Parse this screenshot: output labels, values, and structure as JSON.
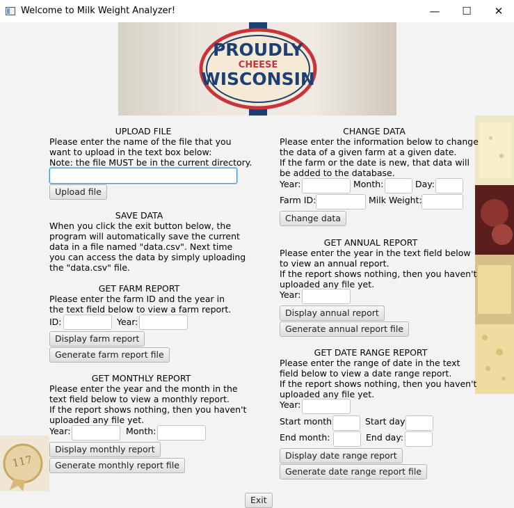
{
  "window": {
    "title": "Welcome to Milk Weight Analyzer!",
    "minimize": "—",
    "maximize": "☐",
    "close": "✕"
  },
  "banner": {
    "line1": "PROUDLY",
    "line2": "CHEESE",
    "line3": "WISCONSIN"
  },
  "badge": {
    "text": "117"
  },
  "upload": {
    "heading": "UPLOAD FILE",
    "line1": "Please enter the name of the file that you",
    "line2": "want to upload in the text box below:",
    "line3": "Note: the file MUST be in the current directory.",
    "value": "",
    "button": "Upload file"
  },
  "save": {
    "heading": "SAVE DATA",
    "lines": [
      "When you click the exit button below, the",
      "program will automatically save the current",
      "data in a file named \"data.csv\". Next time",
      "you can access the data by simply uploading",
      "the \"data.csv\" file."
    ]
  },
  "farm": {
    "heading": "GET FARM REPORT",
    "line1": "Please enter the farm ID and the year in",
    "line2": "the text field below to view a farm report.",
    "id_label": "ID:",
    "year_label": "Year:",
    "display_button": "Display farm report",
    "generate_button": "Generate farm report file"
  },
  "monthly": {
    "heading": "GET MONTHLY REPORT",
    "lines": [
      "Please enter the year and the month in the",
      "text field below to view a monthly report.",
      "If the report shows nothing, then you haven't",
      "uploaded any file yet."
    ],
    "year_label": "Year:",
    "month_label": "Month:",
    "display_button": "Display monthly report",
    "generate_button": "Generate monthly report file"
  },
  "change": {
    "heading": "CHANGE DATA",
    "lines": [
      "Please enter the information below to change",
      "the data of a given farm at a given date.",
      "If the farm or the date is new, that data will",
      "be added to the database."
    ],
    "year_label": "Year:",
    "month_label": "Month:",
    "day_label": "Day:",
    "farm_id_label": "Farm ID:",
    "milk_weight_label": "Milk Weight:",
    "button": "Change data"
  },
  "annual": {
    "heading": "GET ANNUAL REPORT",
    "lines": [
      "Please enter the year in the text field below",
      "to view an annual report.",
      "If the report shows nothing, then you haven't",
      "uploaded any file yet."
    ],
    "year_label": "Year:",
    "display_button": "Display annual report",
    "generate_button": "Generate annual report file"
  },
  "daterange": {
    "heading": "GET DATE RANGE REPORT",
    "lines": [
      "Please enter the range of date in the text",
      "field below to view a date range report.",
      "If the report shows nothing, then you haven't",
      "uploaded any file yet."
    ],
    "year_label": "Year:",
    "start_month_label": "Start month:",
    "start_day_label": "Start day:",
    "end_month_label": "End month:",
    "end_day_label": "End day:",
    "display_button": "Display date range report",
    "generate_button": "Generate date range report file"
  },
  "exit_button": "Exit"
}
